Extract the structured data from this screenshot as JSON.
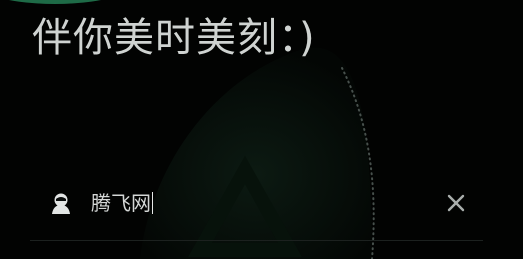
{
  "header": {
    "greeting": "伴你美时美刻：)"
  },
  "login_form": {
    "username_value": "腾飞网",
    "user_icon": "user-avatar-icon",
    "clear_icon": "close-icon"
  },
  "colors": {
    "background": "#020302",
    "accent": "#1e6b47",
    "text": "#cfd3d1"
  }
}
